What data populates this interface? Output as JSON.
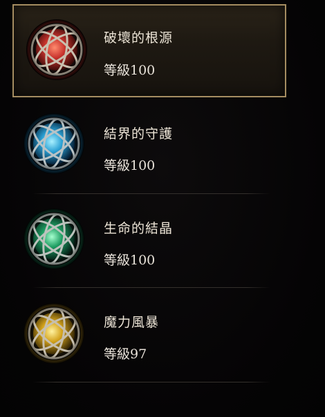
{
  "skills": [
    {
      "name": "破壞的根源",
      "level": "等級100",
      "color": "#c8332d",
      "glow": "#ff6a4a",
      "selected": true
    },
    {
      "name": "結界的守護",
      "level": "等級100",
      "color": "#2aa0d4",
      "glow": "#7fe0ff",
      "selected": false
    },
    {
      "name": "生命的結晶",
      "level": "等級100",
      "color": "#1e9d62",
      "glow": "#6ff0a8",
      "selected": false
    },
    {
      "name": "魔力風暴",
      "level": "等級97",
      "color": "#d3a21c",
      "glow": "#ffe06a",
      "selected": false
    }
  ]
}
